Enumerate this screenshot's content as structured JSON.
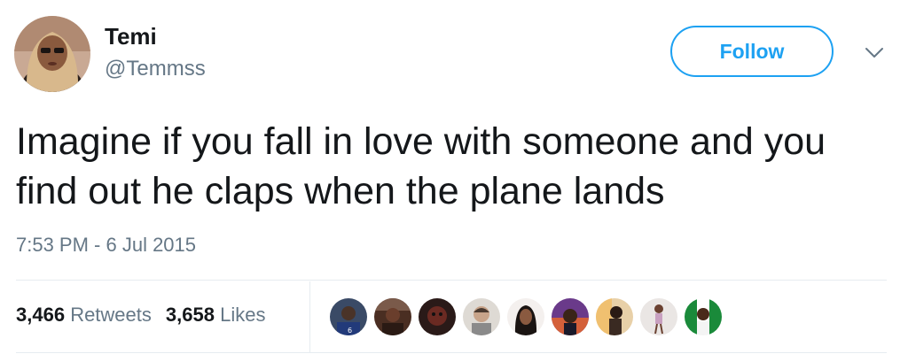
{
  "user": {
    "name": "Temi",
    "handle": "@Temmss"
  },
  "follow_button": {
    "label": "Follow"
  },
  "tweet": {
    "text": "Imagine if you fall in love with someone and you find out he claps when the plane lands",
    "timestamp": "7:53 PM - 6 Jul 2015"
  },
  "stats": {
    "retweets_count": "3,466",
    "retweets_label": "Retweets",
    "likes_count": "3,658",
    "likes_label": "Likes"
  },
  "colors": {
    "accent": "#1da1f2",
    "text_primary": "#14171a",
    "text_secondary": "#657786",
    "divider": "#e6ecf0"
  },
  "icons": {
    "more_menu": "chevron-down-icon"
  }
}
